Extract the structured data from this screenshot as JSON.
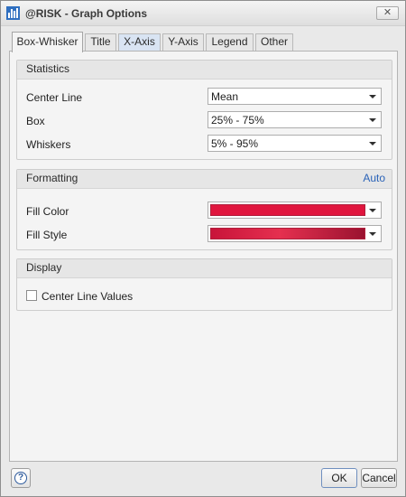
{
  "window": {
    "title": "@RISK - Graph Options",
    "close_glyph": "✕"
  },
  "tabs": [
    {
      "label": "Box-Whisker",
      "active": true
    },
    {
      "label": "Title"
    },
    {
      "label": "X-Axis"
    },
    {
      "label": "Y-Axis"
    },
    {
      "label": "Legend"
    },
    {
      "label": "Other"
    }
  ],
  "statistics": {
    "header": "Statistics",
    "center_line": {
      "label": "Center Line",
      "value": "Mean"
    },
    "box": {
      "label": "Box",
      "value": "25% - 75%"
    },
    "whiskers": {
      "label": "Whiskers",
      "value": "5% - 95%"
    }
  },
  "formatting": {
    "header": "Formatting",
    "auto_link": "Auto",
    "fill_color": {
      "label": "Fill Color",
      "color": "#e0163e"
    },
    "fill_style": {
      "label": "Fill Style",
      "color": "#c8143a"
    }
  },
  "display": {
    "header": "Display",
    "center_line_values": {
      "label": "Center Line Values",
      "checked": false
    }
  },
  "footer": {
    "help_glyph": "?",
    "ok_label": "OK",
    "cancel_label": "Cancel"
  },
  "colors": {
    "accent_link": "#2a63b8",
    "window_bg": "#e9e9e9"
  }
}
